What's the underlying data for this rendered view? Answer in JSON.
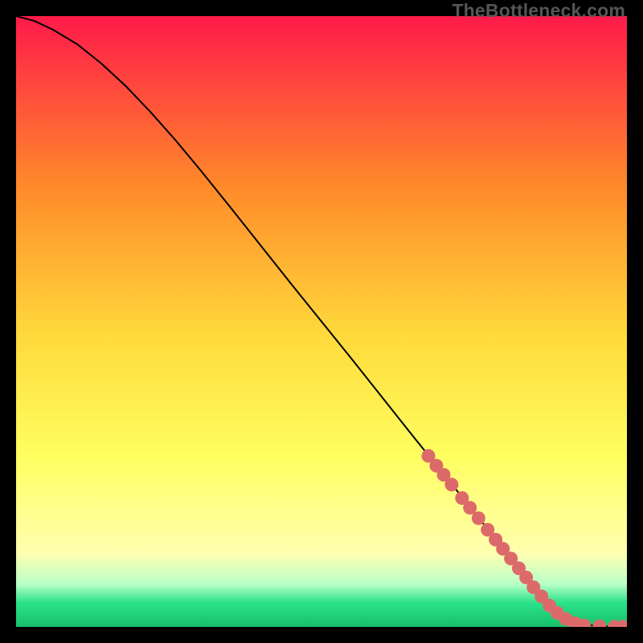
{
  "watermark": "TheBottleneck.com",
  "colors": {
    "bg": "#000000",
    "curve": "#000000",
    "marker_fill": "#dd6a6a",
    "marker_stroke": "#c05555",
    "grad_top": "#ff1a4a",
    "grad_mid_upper": "#ff8a2a",
    "grad_mid": "#ffd93b",
    "grad_mid_lower": "#ffff60",
    "grad_yellow_pale": "#ffffb0",
    "grad_green_pale": "#b8ffc8",
    "grad_green": "#2be38a",
    "grad_green_deep": "#18c06a"
  },
  "chart_data": {
    "type": "line",
    "title": "",
    "xlabel": "",
    "ylabel": "",
    "xlim": [
      0,
      100
    ],
    "ylim": [
      0,
      100
    ],
    "curve": {
      "x": [
        0,
        3,
        6,
        10,
        14,
        18,
        22,
        26,
        30,
        35,
        40,
        45,
        50,
        55,
        60,
        65,
        70,
        75,
        80,
        82,
        85,
        88,
        90,
        92,
        95,
        98,
        100
      ],
      "y": [
        100,
        99.2,
        97.8,
        95.4,
        92.2,
        88.5,
        84.3,
        79.8,
        75.0,
        68.8,
        62.5,
        56.2,
        50.0,
        43.8,
        37.5,
        31.2,
        25.0,
        18.8,
        12.5,
        10.0,
        6.3,
        3.0,
        1.5,
        0.6,
        0.15,
        0.03,
        0.0
      ]
    },
    "markers": [
      {
        "x": 67.5,
        "y": 28.0
      },
      {
        "x": 68.8,
        "y": 26.4
      },
      {
        "x": 70.0,
        "y": 24.9
      },
      {
        "x": 71.3,
        "y": 23.3
      },
      {
        "x": 73.0,
        "y": 21.1
      },
      {
        "x": 74.3,
        "y": 19.5
      },
      {
        "x": 75.7,
        "y": 17.8
      },
      {
        "x": 77.2,
        "y": 15.9
      },
      {
        "x": 78.5,
        "y": 14.3
      },
      {
        "x": 79.7,
        "y": 12.8
      },
      {
        "x": 81.0,
        "y": 11.2
      },
      {
        "x": 82.3,
        "y": 9.6
      },
      {
        "x": 83.5,
        "y": 8.1
      },
      {
        "x": 84.7,
        "y": 6.5
      },
      {
        "x": 86.0,
        "y": 5.0
      },
      {
        "x": 87.3,
        "y": 3.5
      },
      {
        "x": 88.6,
        "y": 2.3
      },
      {
        "x": 90.0,
        "y": 1.3
      },
      {
        "x": 91.5,
        "y": 0.6
      },
      {
        "x": 93.0,
        "y": 0.25
      },
      {
        "x": 95.5,
        "y": 0.1
      },
      {
        "x": 98.0,
        "y": 0.03
      },
      {
        "x": 99.3,
        "y": 0.01
      }
    ]
  }
}
